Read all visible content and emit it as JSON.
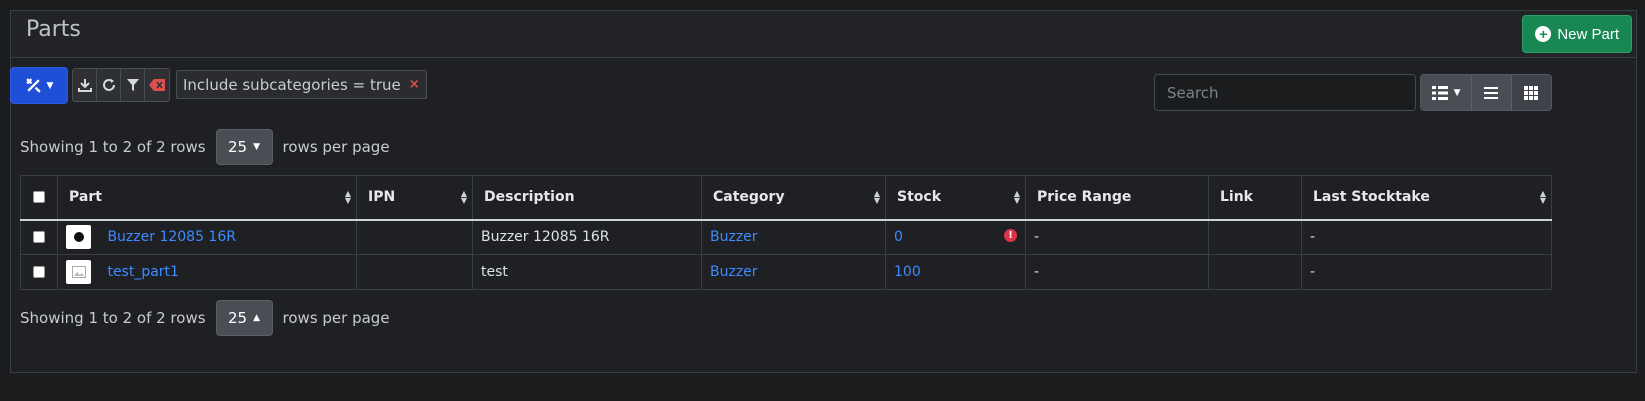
{
  "header": {
    "title": "Parts",
    "new_part_label": "New Part"
  },
  "toolbar": {
    "filter_chip": "Include subcategories = true",
    "search_placeholder": "Search"
  },
  "pagination": {
    "summary": "Showing 1 to 2 of 2 rows",
    "rows_per_page": "25",
    "rows_per_page_label": "rows per page"
  },
  "table": {
    "columns": [
      "Part",
      "IPN",
      "Description",
      "Category",
      "Stock",
      "Price Range",
      "Link",
      "Last Stocktake"
    ],
    "rows": [
      {
        "part": "Buzzer 12085 16R",
        "ipn": "",
        "description": "Buzzer 12085 16R",
        "category": "Buzzer",
        "stock": "0",
        "price_range": "-",
        "link": "",
        "last_stocktake": "-"
      },
      {
        "part": "test_part1",
        "ipn": "",
        "description": "test",
        "category": "Buzzer",
        "stock": "100",
        "price_range": "-",
        "link": "",
        "last_stocktake": "-"
      }
    ]
  },
  "colors": {
    "accent": "#1f4fd6",
    "success": "#198754",
    "link": "#3d8bfd",
    "danger": "#dc3545"
  }
}
